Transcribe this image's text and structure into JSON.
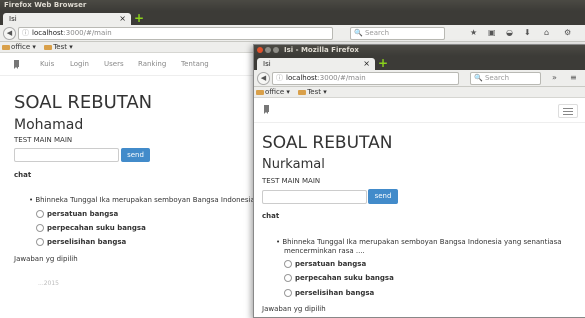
{
  "windowA": {
    "title": "Firefox Web Browser",
    "tab_label": "Isi",
    "tab_close": "×",
    "new_tab": "+",
    "back": "◀",
    "url_host": "localhost",
    "url_path": ":3000/#/main",
    "search_placeholder": "Search",
    "bookmarks": [
      "office ▾",
      "Test ▾"
    ],
    "nav_items": [
      "Kuis",
      "Login",
      "Users",
      "Ranking",
      "Tentang"
    ],
    "app_title": "SOAL REBUTAN",
    "user_name": "Mohamad",
    "section_label": "TEST MAIN MAIN",
    "send_label": "send",
    "chat_label": "chat",
    "question": "Bhinneka Tunggal Ika merupakan semboyan Bangsa Indonesia yang",
    "options": [
      "persatuan bangsa",
      "perpecahan suku bangsa",
      "perselisihan bangsa"
    ],
    "answer_label": "Jawaban yg dipilih",
    "footer": "...2015"
  },
  "windowB": {
    "title": "Isi - Mozilla Firefox",
    "tab_label": "Isi",
    "tab_close": "×",
    "new_tab": "+",
    "back": "◀",
    "url_host": "localhost",
    "url_path": ":3000/#/main",
    "search_placeholder": "Search",
    "overflow": "»",
    "menu": "≡",
    "bookmarks": [
      "office ▾",
      "Test ▾"
    ],
    "app_title": "SOAL REBUTAN",
    "user_name": "Nurkamal",
    "section_label": "TEST MAIN MAIN",
    "send_label": "send",
    "chat_label": "chat",
    "question_line1": "Bhinneka Tunggal Ika merupakan semboyan Bangsa Indonesia yang senantiasa",
    "question_line2": "mencerminkan rasa ....",
    "options": [
      "persatuan bangsa",
      "perpecahan suku bangsa",
      "perselisihan bangsa"
    ],
    "answer_label": "Jawaban yg dipilih"
  },
  "colors": {
    "send_button": "#428bca",
    "titlebar": "#3c3b37",
    "close_button": "#e0512c"
  }
}
